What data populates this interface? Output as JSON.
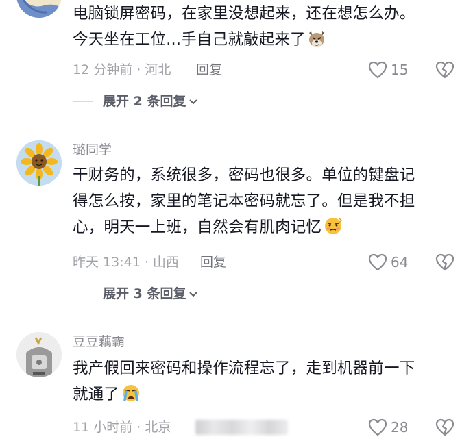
{
  "comments": [
    {
      "text_lines": [
        "电脑锁屏密码，在家里没想起来，还在想怎么办。",
        "今天坐在工位...手自己就敲起来了"
      ],
      "emoji": "dog-face-emoji",
      "time": "12 分钟前 · 河北",
      "reply_label": "回复",
      "likes": "15",
      "expand_label": "展开 2 条回复"
    },
    {
      "username": "璐同学",
      "avatar": "sunflower-avatar",
      "text_lines": [
        "干财务的，系统很多，密码也很多。单位的键盘记",
        "得怎么按，家里的笔记本密码就忘了。但是我不担",
        "心，明天一上班，自然会有肌肉记忆"
      ],
      "emoji": "smirking-face-emoji",
      "time": "昨天 13:41 · 山西",
      "reply_label": "回复",
      "likes": "64",
      "expand_label": "展开 3 条回复"
    },
    {
      "username": "豆豆藕霸",
      "avatar": "character-avatar",
      "text_lines": [
        "我产假回来密码和操作流程忘了，走到机器前一下",
        "就通了"
      ],
      "emoji": "crying-face-emoji",
      "time": "11 小时前 · 北京",
      "likes": "28"
    }
  ],
  "colors": {
    "text": "#161823",
    "meta": "#a2a3a8",
    "username": "#8a8b91",
    "reply": "#73747a"
  }
}
